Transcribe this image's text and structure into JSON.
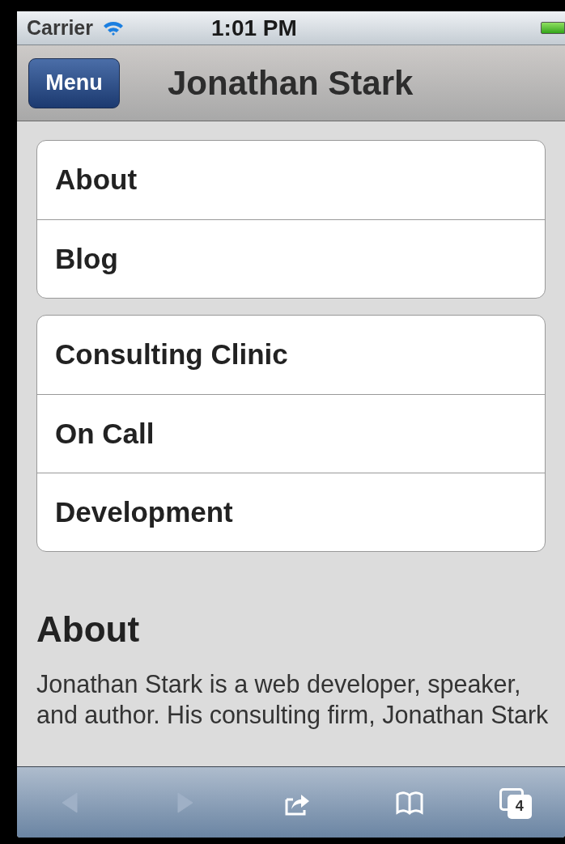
{
  "status_bar": {
    "carrier": "Carrier",
    "time": "1:01 PM"
  },
  "nav_bar": {
    "button": "Menu",
    "title": "Jonathan Stark"
  },
  "menu_groups": [
    {
      "items": [
        "About",
        "Blog"
      ]
    },
    {
      "items": [
        "Consulting Clinic",
        "On Call",
        "Development"
      ]
    }
  ],
  "section": {
    "heading": "About",
    "paragraph": "Jonathan Stark is a web developer, speaker, and author. His consulting firm, Jonathan Stark"
  },
  "toolbar": [
    {
      "kind": "back",
      "disabled": true
    },
    {
      "kind": "forward",
      "disabled": true
    },
    {
      "kind": "share",
      "disabled": false
    },
    {
      "kind": "bookmarks",
      "disabled": false
    },
    {
      "kind": "tabs",
      "disabled": false,
      "count": "4"
    }
  ]
}
